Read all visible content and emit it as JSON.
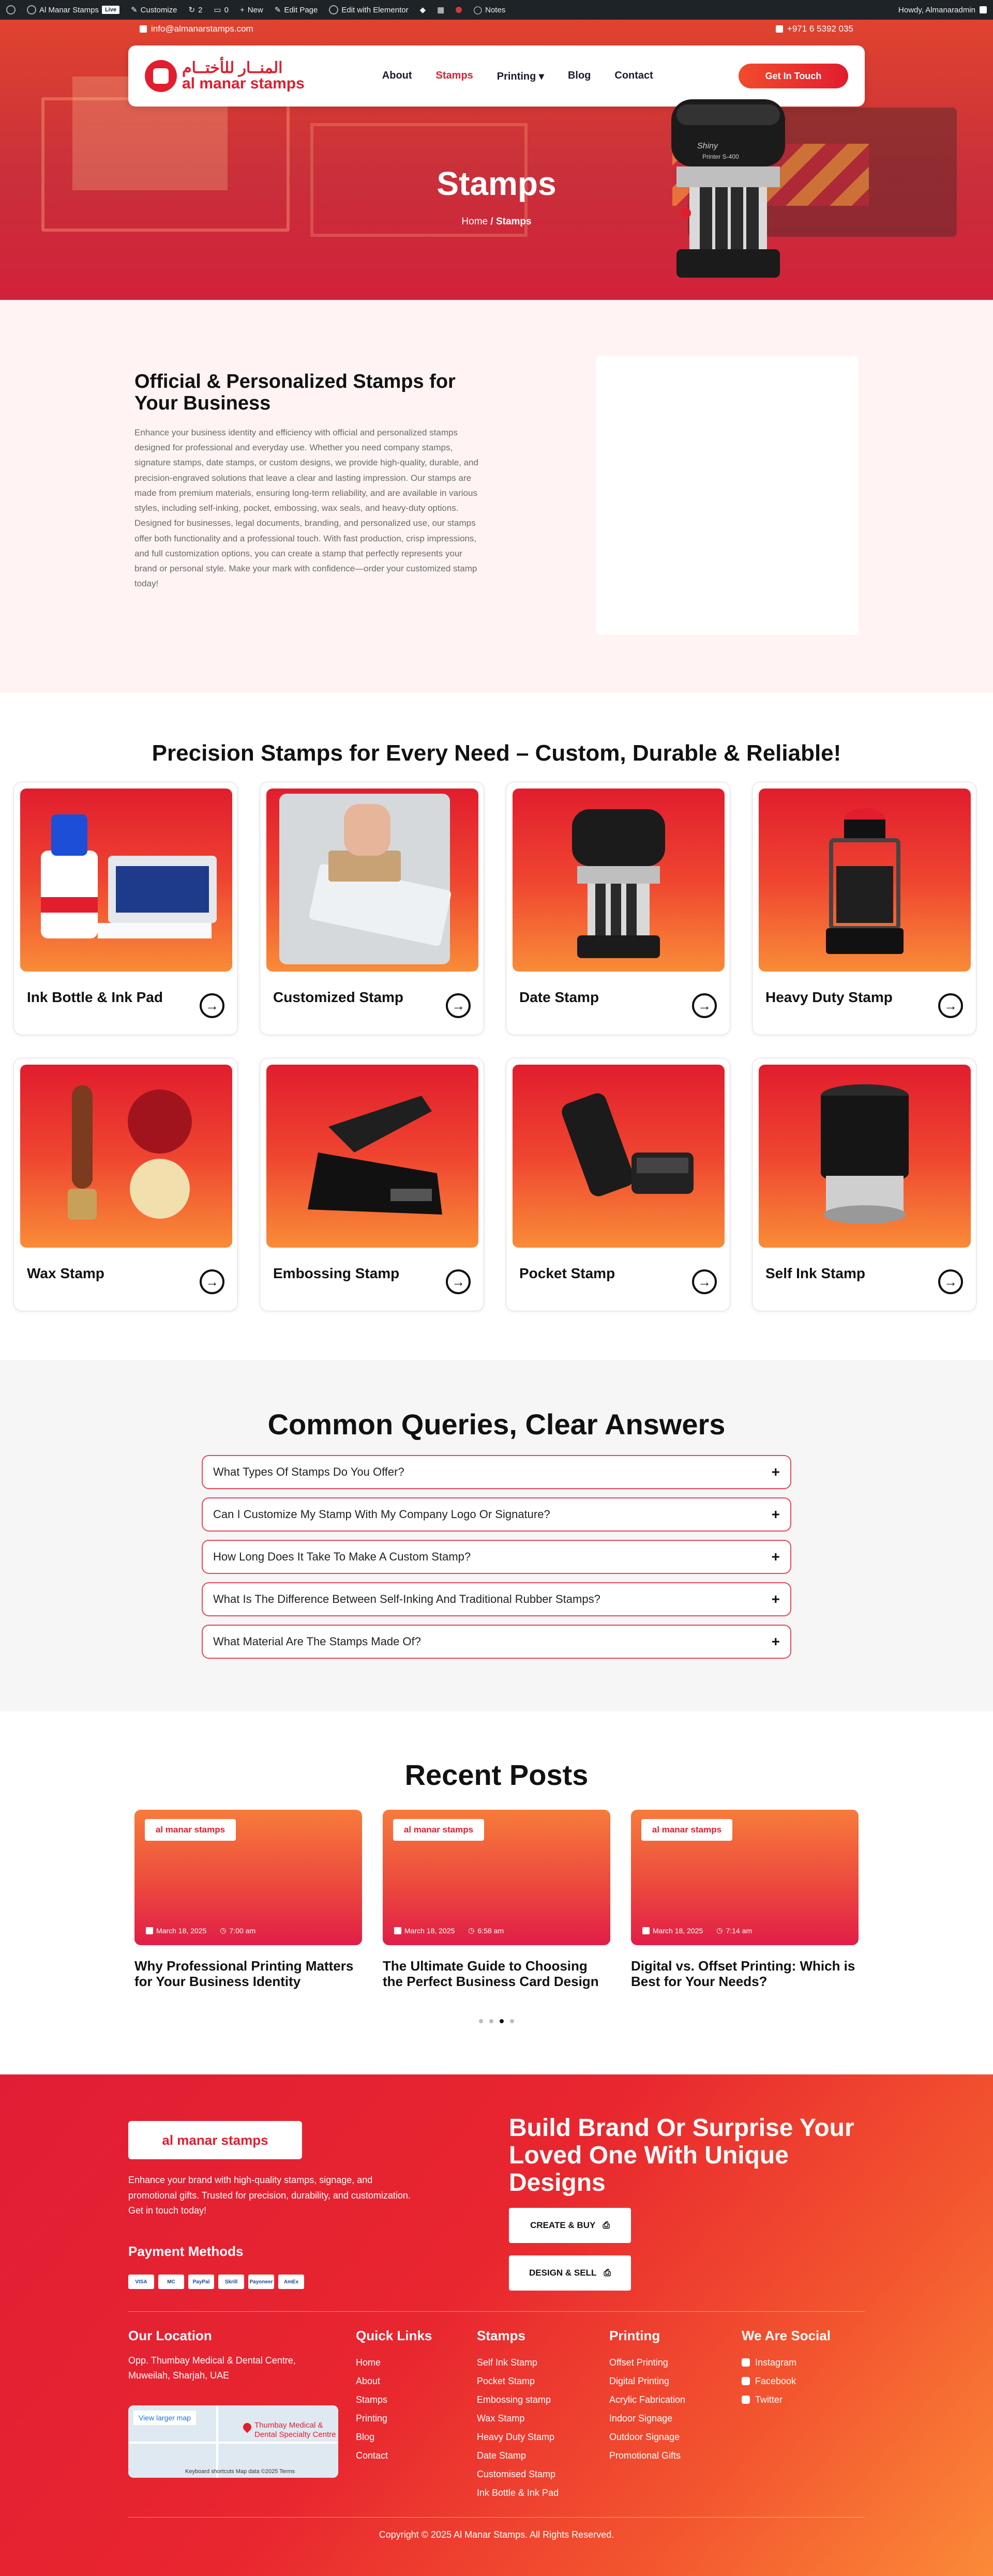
{
  "admin_bar": {
    "site_name": "Al Manar Stamps",
    "live_badge": "Live",
    "customize": "Customize",
    "updates_count": "2",
    "comments_count": "0",
    "new": "New",
    "edit_page": "Edit Page",
    "edit_elementor": "Edit with Elementor",
    "notes": "Notes",
    "howdy": "Howdy, Almanaradmin"
  },
  "topbar": {
    "email": "info@almanarstamps.com",
    "phone": "+971 6 5392 035"
  },
  "logo": {
    "arabic": "المنــار للأختــام",
    "english": "al manar stamps"
  },
  "nav": {
    "items": [
      "About",
      "Stamps",
      "Printing",
      "Blog",
      "Contact"
    ],
    "active": "Stamps",
    "cta": "Get In Touch"
  },
  "hero": {
    "title": "Stamps",
    "breadcrumb_home": "Home",
    "breadcrumb_sep": "/",
    "breadcrumb_current": "Stamps"
  },
  "intro": {
    "heading": "Official & Personalized Stamps for Your Business",
    "body": "Enhance your business identity and efficiency with official and personalized stamps designed for professional and everyday use. Whether you need company stamps, signature stamps, date stamps, or custom designs, we provide high-quality, durable, and precision-engraved solutions that leave a clear and lasting impression. Our stamps are made from premium materials, ensuring long-term reliability, and are available in various styles, including self-inking, pocket, embossing, wax seals, and heavy-duty options. Designed for businesses, legal documents, branding, and personalized use, our stamps offer both functionality and a professional touch. With fast production, crisp impressions, and full customization options, you can create a stamp that perfectly represents your brand or personal style. Make your mark with confidence—order your customized stamp today!",
    "product_brand": "Shiny",
    "product_model": "Printer S-400"
  },
  "products": {
    "heading": "Precision Stamps for Every Need – Custom, Durable & Reliable!",
    "items": [
      {
        "title": "Ink Bottle & Ink Pad"
      },
      {
        "title": "Customized Stamp"
      },
      {
        "title": "Date Stamp"
      },
      {
        "title": "Heavy Duty Stamp"
      },
      {
        "title": "Wax Stamp"
      },
      {
        "title": "Embossing Stamp"
      },
      {
        "title": "Pocket Stamp"
      },
      {
        "title": "Self Ink Stamp"
      }
    ]
  },
  "faq": {
    "heading": "Common Queries, Clear Answers",
    "items": [
      "What Types Of Stamps Do You Offer?",
      "Can I Customize My Stamp With My Company Logo Or Signature?",
      "How Long Does It Take To Make A Custom Stamp?",
      "What Is The Difference Between Self-Inking And Traditional Rubber Stamps?",
      "What Material Are The Stamps Made Of?"
    ]
  },
  "posts": {
    "heading": "Recent Posts",
    "items": [
      {
        "date": "March 18, 2025",
        "time": "7:00 am",
        "title": "Why Professional Printing Matters for Your Business Identity"
      },
      {
        "date": "March 18, 2025",
        "time": "6:58 am",
        "title": "The Ultimate Guide to Choosing the Perfect Business Card Design"
      },
      {
        "date": "March 18, 2025",
        "time": "7:14 am",
        "title": "Digital vs. Offset Printing: Which is Best for Your Needs?"
      }
    ],
    "active_dot": 2
  },
  "footer": {
    "description": "Enhance your brand with high-quality stamps, signage, and promotional gifts. Trusted for precision, durability, and customization. Get in touch today!",
    "payment_title": "Payment Methods",
    "payment_methods": [
      "VISA",
      "MC",
      "PayPal",
      "Skrill",
      "Payoneer",
      "AmEx"
    ],
    "headline": "Build Brand Or Surprise Your Loved One With Unique Designs",
    "btn_create": "CREATE & BUY",
    "btn_design": "DESIGN & SELL",
    "location_title": "Our Location",
    "location_text": "Opp. Thumbay Medical & Dental Centre, Muweilah, Sharjah, UAE",
    "map_link": "View larger map",
    "map_label": "Thumbay Medical & Dental Specialty Centre",
    "map_footer": "Keyboard shortcuts   Map data ©2025   Terms",
    "quick_title": "Quick Links",
    "quick_links": [
      "Home",
      "About",
      "Stamps",
      "Printing",
      "Blog",
      "Contact"
    ],
    "stamps_title": "Stamps",
    "stamps_links": [
      "Self Ink Stamp",
      "Pocket Stamp",
      "Embossing stamp",
      "Wax Stamp",
      "Heavy Duty Stamp",
      "Date Stamp",
      "Customised Stamp",
      "Ink Bottle & Ink Pad"
    ],
    "printing_title": "Printing",
    "printing_links": [
      "Offset Printing",
      "Digital Printing",
      "Acrylic Fabrication",
      "Indoor Signage",
      "Outdoor Signage",
      "Promotional Gifts"
    ],
    "social_title": "We Are Social",
    "social_links": [
      "Instagram",
      "Facebook",
      "Twitter"
    ],
    "copyright": "Copyright © 2025 Al Manar Stamps. All Rights Reserved."
  },
  "colors": {
    "brand_red": "#e11d2e",
    "brand_orange": "#f98c38",
    "dark": "#111111"
  }
}
